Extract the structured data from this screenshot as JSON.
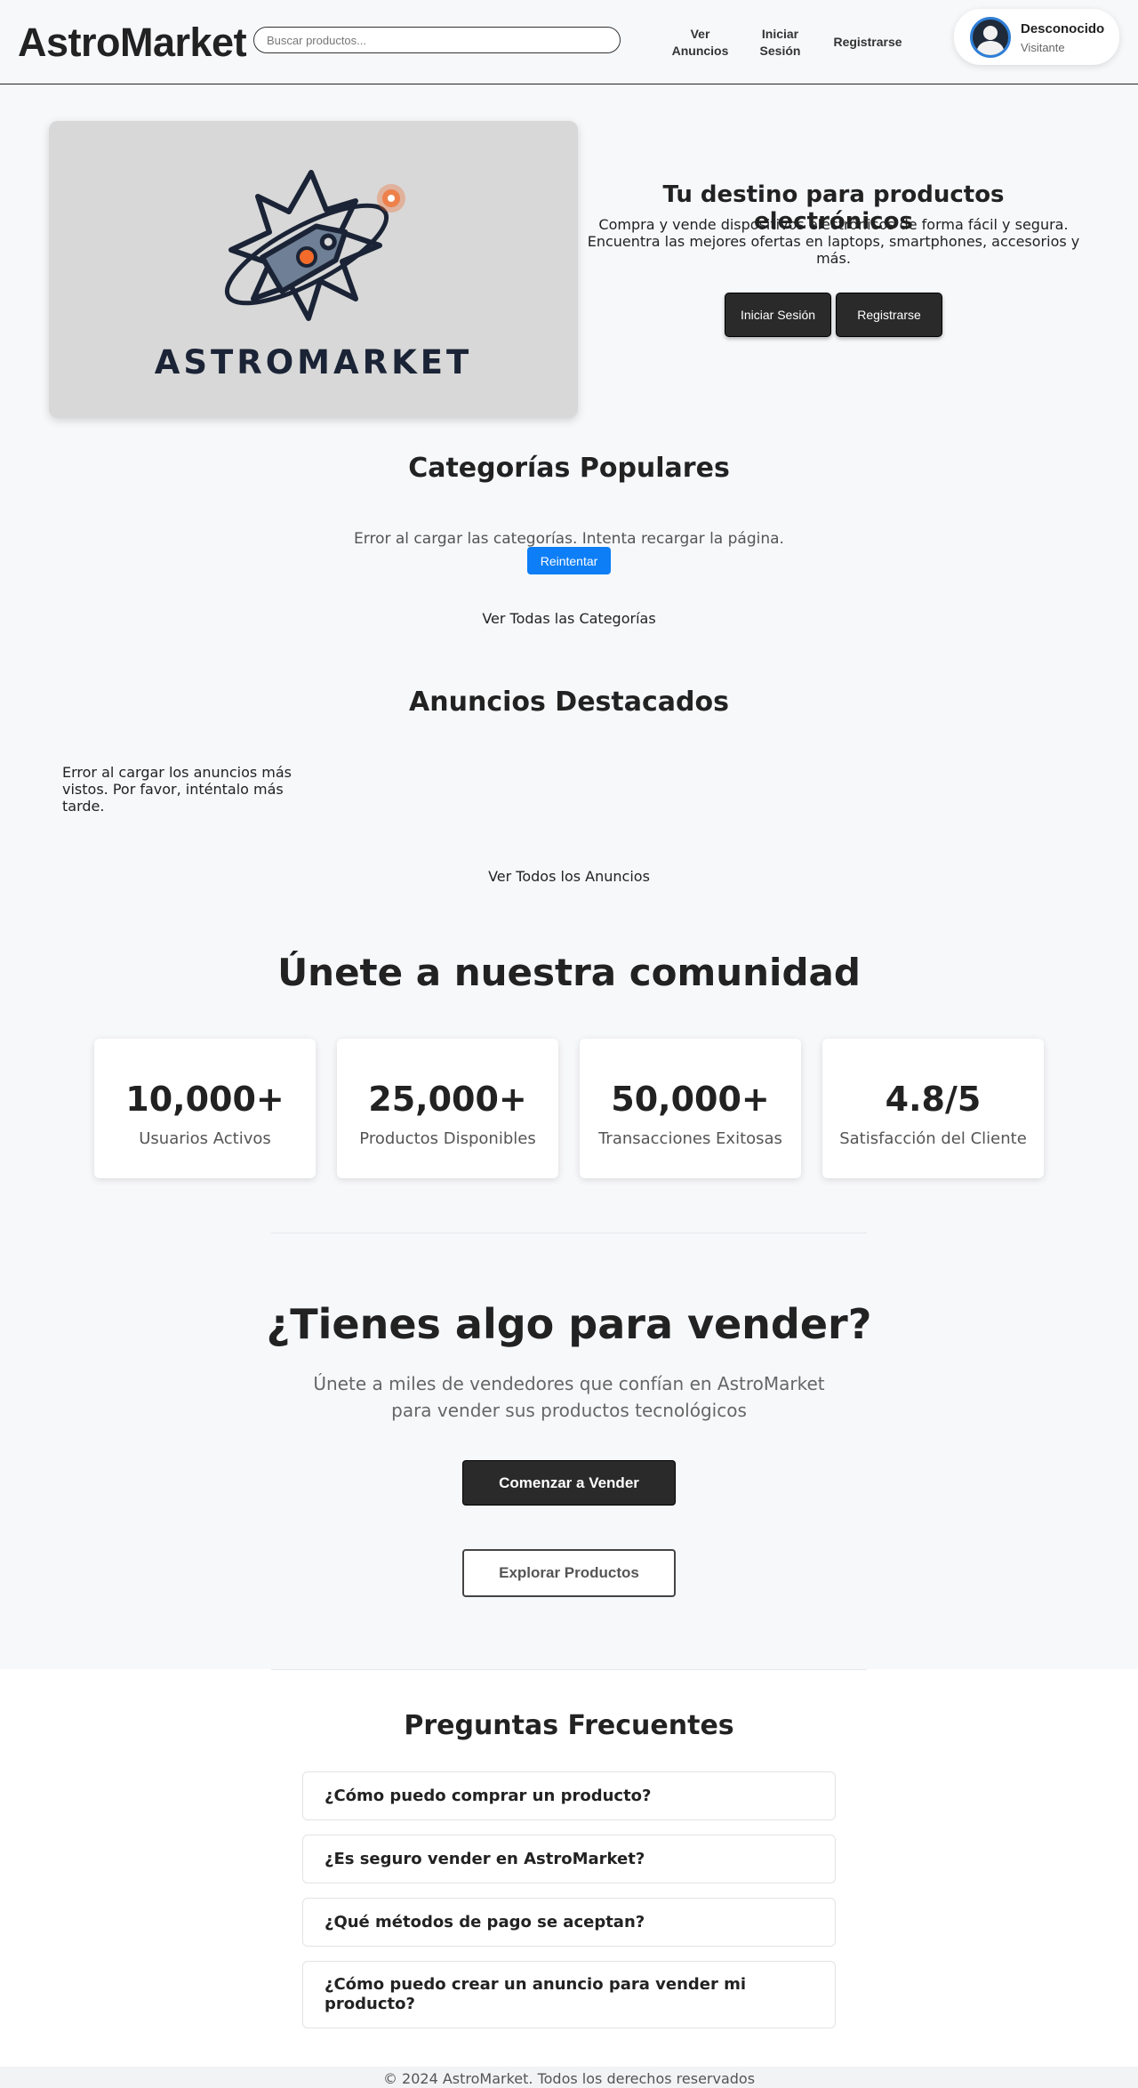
{
  "header": {
    "brand": "AstroMarket",
    "search_placeholder": "Buscar productos...",
    "nav": {
      "anuncios": "Ver\nAnuncios",
      "login": "Iniciar\nSesión",
      "register": "Registrarse"
    },
    "user": {
      "name": "Desconocido",
      "role": "Visitante"
    }
  },
  "hero": {
    "logo_text": "ASTROMARKET",
    "title": "Tu destino para productos electrónicos",
    "subtitle": "Compra y vende dispositivos electrónicos de forma fácil y segura. Encuentra las mejores ofertas en laptops, smartphones, accesorios y más.",
    "login_button": "Iniciar Sesión",
    "register_button": "Registrarse"
  },
  "categories": {
    "title": "Categorías Populares",
    "error": "Error al cargar las categorías. Intenta recargar la página.",
    "retry_button": "Reintentar",
    "view_all": "Ver Todas las Categorías"
  },
  "featured": {
    "title": "Anuncios Destacados",
    "error": "Error al cargar los anuncios más vistos. Por favor, inténtalo más tarde.",
    "view_all": "Ver Todos los Anuncios"
  },
  "community": {
    "title": "Únete a nuestra comunidad",
    "stats": [
      {
        "value": "10,000+",
        "label": "Usuarios Activos"
      },
      {
        "value": "25,000+",
        "label": "Productos Disponibles"
      },
      {
        "value": "50,000+",
        "label": "Transacciones Exitosas"
      },
      {
        "value": "4.8/5",
        "label": "Satisfacción del Cliente"
      }
    ]
  },
  "sell": {
    "title": "¿Tienes algo para vender?",
    "subtitle": "Únete a miles de vendedores que confían en AstroMarket para vender sus productos tecnológicos",
    "start_button": "Comenzar a Vender",
    "explore_button": "Explorar Productos"
  },
  "faq": {
    "title": "Preguntas Frecuentes",
    "items": [
      "¿Cómo puedo comprar un producto?",
      "¿Es seguro vender en AstroMarket?",
      "¿Qué métodos de pago se aceptan?",
      "¿Cómo puedo crear un anuncio para vender mi producto?"
    ]
  },
  "footer": {
    "text": "© 2024 AstroMarket. Todos los derechos reservados"
  },
  "colors": {
    "page_bg": "#f7f8fa",
    "dark_button": "#2a2a2a",
    "retry_button": "#0d7ef5",
    "logo_accent": "#f26b2a"
  }
}
